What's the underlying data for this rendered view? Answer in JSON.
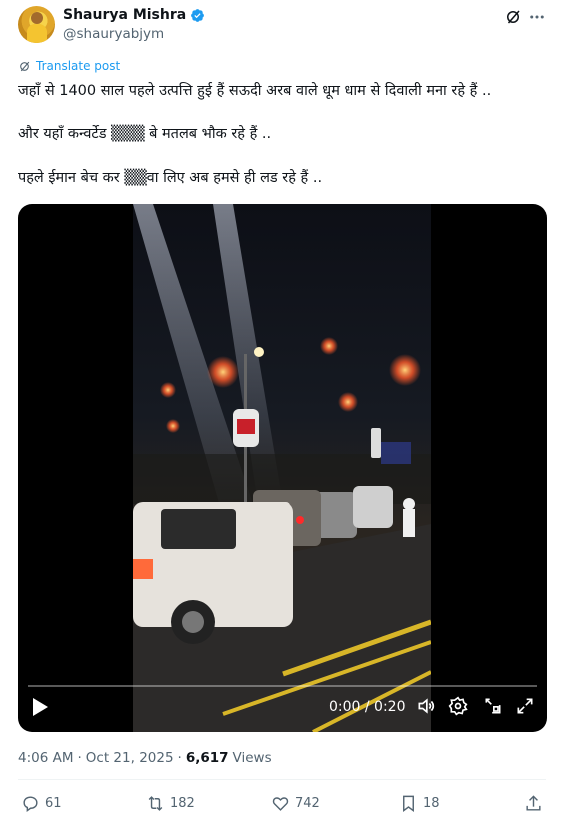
{
  "author": {
    "name": "Shaurya Mishra",
    "handle": "@shauryabjym",
    "verified": true
  },
  "translate_label": "Translate post",
  "post_lines": [
    "जहाँ से 1400 साल पहले उत्पत्ति हुई हैं सऊदी अरब वाले धूम धाम से दिवाली मना रहे हैं ..",
    "और यहाँ कन्वर्टेड ▒▒▒ बे मतलब भौक रहे हैं ..",
    "पहले ईमान बेच कर ▒▒वा लिए अब हमसे ही लड रहे हैं .."
  ],
  "video": {
    "time": "0:00 / 0:20",
    "progress": 0
  },
  "meta": {
    "time": "4:06 AM",
    "separator1": "·",
    "date": "Oct 21, 2025",
    "separator2": "·",
    "views_count": "6,617",
    "views_label": "Views"
  },
  "actions": {
    "replies": "61",
    "reposts": "182",
    "likes": "742",
    "bookmarks": "18"
  },
  "colors": {
    "accent": "#1d9bf0",
    "text": "#0f1419",
    "muted": "#536471"
  },
  "icons": [
    "verified-badge-icon",
    "grok-icon",
    "more-icon",
    "translate-icon",
    "play-icon",
    "volume-icon",
    "settings-icon",
    "pip-icon",
    "fullscreen-icon",
    "reply-icon",
    "repost-icon",
    "like-icon",
    "bookmark-icon",
    "share-icon"
  ]
}
